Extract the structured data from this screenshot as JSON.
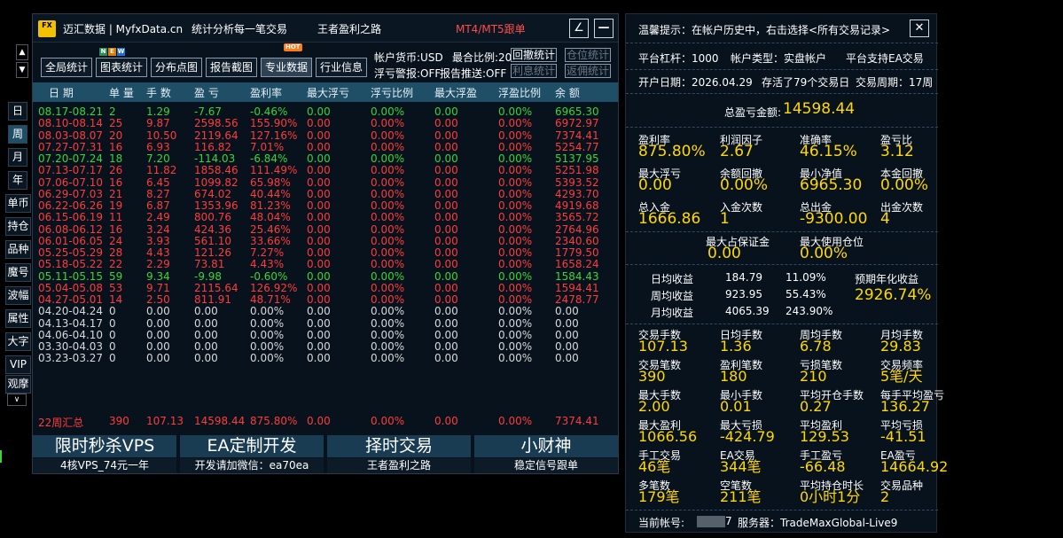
{
  "titlebar": {
    "logo": "FX",
    "app": "迈汇数据 | MyfxData.cn",
    "stat": "统计分析每一笔交易",
    "brand": "王者盈利之路",
    "mt": "MT4/MT5跟单",
    "minimize_icon": "∠",
    "close_icon": "—"
  },
  "toolbar": {
    "buttons": [
      "全局统计",
      "图表统计",
      "分布点图",
      "报告截图",
      "专业数据",
      "行业信息"
    ],
    "new_badge": [
      "N",
      "E",
      "W"
    ],
    "hot_badge": "HOT",
    "info1": "帐户货币:USD",
    "info2": "最合比例:20%",
    "info3": "浮亏警报:OFF",
    "info4": "报告推送:OFF",
    "small": [
      "回撤统计",
      "仓位统计",
      "利息统计",
      "返佣统计"
    ]
  },
  "side_tabs": [
    "日",
    "周",
    "月",
    "年",
    "单币",
    "持仓",
    "品种",
    "魔号",
    "波幅",
    "属性",
    "大字",
    "VIP",
    "观摩"
  ],
  "arrows": {
    "up": "▲",
    "down": "▼",
    "more": "∨"
  },
  "table": {
    "headers": [
      "日 期",
      "单 量",
      "手 数",
      "盈 亏",
      "盈利率",
      "最大浮亏",
      "浮亏比例",
      "最大浮盈",
      "浮盈比例",
      "余 额"
    ],
    "rows": [
      {
        "c": "g",
        "v": [
          "08.17-08.21",
          "2",
          "1.29",
          "-7.67",
          "-0.46%",
          "0.00",
          "0.00%",
          "0.00",
          "0.00%",
          "6965.30"
        ]
      },
      {
        "c": "r",
        "v": [
          "08.10-08.14",
          "25",
          "9.87",
          "2598.56",
          "155.90%",
          "0.00",
          "0.00%",
          "0.00",
          "0.00%",
          "6972.97"
        ]
      },
      {
        "c": "r",
        "v": [
          "08.03-08.07",
          "20",
          "10.50",
          "2119.64",
          "127.16%",
          "0.00",
          "0.00%",
          "0.00",
          "0.00%",
          "7374.41"
        ]
      },
      {
        "c": "r",
        "v": [
          "07.27-07.31",
          "16",
          "6.93",
          "116.82",
          "7.01%",
          "0.00",
          "0.00%",
          "0.00",
          "0.00%",
          "5254.77"
        ]
      },
      {
        "c": "g",
        "v": [
          "07.20-07.24",
          "18",
          "7.20",
          "-114.03",
          "-6.84%",
          "0.00",
          "0.00%",
          "0.00",
          "0.00%",
          "5137.95"
        ]
      },
      {
        "c": "r",
        "v": [
          "07.13-07.17",
          "26",
          "11.82",
          "1858.46",
          "111.49%",
          "0.00",
          "0.00%",
          "0.00",
          "0.00%",
          "5251.98"
        ]
      },
      {
        "c": "r",
        "v": [
          "07.06-07.10",
          "16",
          "6.45",
          "1099.82",
          "65.98%",
          "0.00",
          "0.00%",
          "0.00",
          "0.00%",
          "5393.52"
        ]
      },
      {
        "c": "r",
        "v": [
          "06.29-07.03",
          "21",
          "8.27",
          "674.02",
          "40.44%",
          "0.00",
          "0.00%",
          "0.00",
          "0.00%",
          "4293.70"
        ]
      },
      {
        "c": "r",
        "v": [
          "06.22-06.26",
          "19",
          "6.87",
          "1353.96",
          "81.23%",
          "0.00",
          "0.00%",
          "0.00",
          "0.00%",
          "4919.68"
        ]
      },
      {
        "c": "r",
        "v": [
          "06.15-06.19",
          "11",
          "2.49",
          "800.76",
          "48.04%",
          "0.00",
          "0.00%",
          "0.00",
          "0.00%",
          "3565.72"
        ]
      },
      {
        "c": "r",
        "v": [
          "06.08-06.12",
          "16",
          "3.24",
          "424.36",
          "25.46%",
          "0.00",
          "0.00%",
          "0.00",
          "0.00%",
          "2764.96"
        ]
      },
      {
        "c": "r",
        "v": [
          "06.01-06.05",
          "24",
          "3.93",
          "561.10",
          "33.66%",
          "0.00",
          "0.00%",
          "0.00",
          "0.00%",
          "2340.60"
        ]
      },
      {
        "c": "r",
        "v": [
          "05.25-05.29",
          "28",
          "4.43",
          "121.26",
          "7.27%",
          "0.00",
          "0.00%",
          "0.00",
          "0.00%",
          "1779.50"
        ]
      },
      {
        "c": "r",
        "v": [
          "05.18-05.22",
          "22",
          "2.29",
          "73.81",
          "4.43%",
          "0.00",
          "0.00%",
          "0.00",
          "0.00%",
          "1658.24"
        ]
      },
      {
        "c": "g",
        "v": [
          "05.11-05.15",
          "59",
          "9.34",
          "-9.98",
          "-0.60%",
          "0.00",
          "0.00%",
          "0.00",
          "0.00%",
          "1584.43"
        ]
      },
      {
        "c": "r",
        "v": [
          "05.04-05.08",
          "53",
          "9.71",
          "2115.64",
          "126.92%",
          "0.00",
          "0.00%",
          "0.00",
          "0.00%",
          "1594.41"
        ]
      },
      {
        "c": "r",
        "v": [
          "04.27-05.01",
          "14",
          "2.50",
          "811.91",
          "48.71%",
          "0.00",
          "0.00%",
          "0.00",
          "0.00%",
          "2478.77"
        ]
      },
      {
        "c": "w",
        "v": [
          "04.20-04.24",
          "0",
          "0.00",
          "0.00",
          "0.00%",
          "0.00",
          "0.00%",
          "0.00",
          "0.00%",
          "0.00"
        ]
      },
      {
        "c": "w",
        "v": [
          "04.13-04.17",
          "0",
          "0.00",
          "0.00",
          "0.00%",
          "0.00",
          "0.00%",
          "0.00",
          "0.00%",
          "0.00"
        ]
      },
      {
        "c": "w",
        "v": [
          "04.06-04.10",
          "0",
          "0.00",
          "0.00",
          "0.00%",
          "0.00",
          "0.00%",
          "0.00",
          "0.00%",
          "0.00"
        ]
      },
      {
        "c": "w",
        "v": [
          "03.30-04.03",
          "0",
          "0.00",
          "0.00",
          "0.00%",
          "0.00",
          "0.00%",
          "0.00",
          "0.00%",
          "0.00"
        ]
      },
      {
        "c": "w",
        "v": [
          "03.23-03.27",
          "0",
          "0.00",
          "0.00",
          "0.00%",
          "0.00",
          "0.00%",
          "0.00",
          "0.00%",
          "0.00"
        ]
      }
    ],
    "summary": [
      "22周汇总",
      "390",
      "107.13",
      "14598.44",
      "875.80%",
      "0.00",
      "0.00%",
      "0.00",
      "0.00%",
      "7374.41"
    ]
  },
  "ads": [
    {
      "big": "限时秒杀VPS",
      "small": "4核VPS_74元一年"
    },
    {
      "big": "EA定制开发",
      "small": "开发请加微信：ea70ea"
    },
    {
      "big": "择时交易",
      "small": "王者盈利之路"
    },
    {
      "big": "小财神",
      "small": "稳定信号跟单"
    }
  ],
  "right": {
    "tip": "温馨提示：在帐户历史中，右击选择<所有交易记录>",
    "close_icon": "✕",
    "leverage": "平台杠杆：1000",
    "acc_type": "帐户类型：实盘帐户",
    "ea_support": "平台支持EA交易",
    "open_date": "开户日期：2026.04.29",
    "alive": "存活了79个交易日",
    "cycle": "交易周期：17周",
    "total_label": "总盈亏金额:",
    "total_value": "14598.44",
    "g1": [
      {
        "l": "盈利率",
        "v": "875.80%"
      },
      {
        "l": "利润因子",
        "v": "2.67"
      },
      {
        "l": "准确率",
        "v": "46.15%"
      },
      {
        "l": "盈亏比",
        "v": "3.12"
      },
      {
        "l": "最大浮亏",
        "v": "0.00"
      },
      {
        "l": "余额回撤",
        "v": "0.00%"
      },
      {
        "l": "最小净值",
        "v": "6965.30"
      },
      {
        "l": "本金回撤",
        "v": "0.00%"
      },
      {
        "l": "总入金",
        "v": "1666.86"
      },
      {
        "l": "入金次数",
        "v": "1"
      },
      {
        "l": "总出金",
        "v": "-9300.00"
      },
      {
        "l": "出金次数",
        "v": "4"
      }
    ],
    "margin": [
      {
        "l": "最大占保证金",
        "v": "0.00"
      },
      {
        "l": "最大使用仓位",
        "v": "0.00%"
      }
    ],
    "avg": [
      {
        "l": "日均收益",
        "a": "184.79",
        "b": "11.09%"
      },
      {
        "l": "周均收益",
        "a": "923.95",
        "b": "55.43%"
      },
      {
        "l": "月均收益",
        "a": "4065.39",
        "b": "243.90%"
      }
    ],
    "annual_label": "预期年化收益",
    "annual_value": "2926.74%",
    "g2": [
      {
        "l": "交易手数",
        "v": "107.13"
      },
      {
        "l": "日均手数",
        "v": "1.36"
      },
      {
        "l": "周均手数",
        "v": "6.78"
      },
      {
        "l": "月均手数",
        "v": "29.83"
      },
      {
        "l": "交易笔数",
        "v": "390"
      },
      {
        "l": "盈利笔数",
        "v": "180"
      },
      {
        "l": "亏损笔数",
        "v": "210"
      },
      {
        "l": "交易频率",
        "v": "5笔/天"
      },
      {
        "l": "最大手数",
        "v": "2.00"
      },
      {
        "l": "最小手数",
        "v": "0.01"
      },
      {
        "l": "平均开仓手数",
        "v": "0.27"
      },
      {
        "l": "每手平均盈亏",
        "v": "136.27"
      },
      {
        "l": "最大盈利",
        "v": "1066.56"
      },
      {
        "l": "最大亏损",
        "v": "-424.79"
      },
      {
        "l": "平均盈利",
        "v": "129.53"
      },
      {
        "l": "平均亏损",
        "v": "-41.51"
      },
      {
        "l": "手工交易",
        "v": "46笔"
      },
      {
        "l": "EA交易",
        "v": "344笔"
      },
      {
        "l": "手工盈亏",
        "v": "-66.48"
      },
      {
        "l": "EA盈亏",
        "v": "14664.92"
      },
      {
        "l": "多笔数",
        "v": "179笔"
      },
      {
        "l": "空笔数",
        "v": "211笔"
      },
      {
        "l": "平均持仓时长",
        "v": "0小时1分"
      },
      {
        "l": "交易品种",
        "v": "2"
      }
    ],
    "account_label": "当前帐号:",
    "account_tail": "7",
    "server": "服务器：TradeMaxGlobal-Live9"
  }
}
